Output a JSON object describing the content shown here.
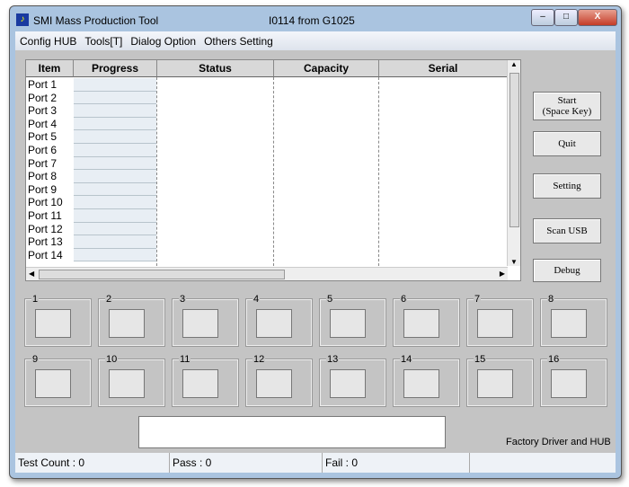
{
  "window": {
    "title": "SMI Mass Production Tool",
    "version": "I0114 from G1025",
    "minimize": "–",
    "maximize": "□",
    "close": "X"
  },
  "menu": [
    "Config HUB",
    "Tools[T]",
    "Dialog Option",
    "Others Setting"
  ],
  "table": {
    "headers": [
      "Item",
      "Progress",
      "Status",
      "Capacity",
      "Serial"
    ],
    "rows": [
      "Port 1",
      "Port 2",
      "Port 3",
      "Port 4",
      "Port 5",
      "Port 6",
      "Port 7",
      "Port 8",
      "Port 9",
      "Port 10",
      "Port 11",
      "Port 12",
      "Port 13",
      "Port 14"
    ]
  },
  "buttons": {
    "start": "Start\n(Space Key)",
    "quit": "Quit",
    "setting": "Setting",
    "scan": "Scan USB",
    "debug": "Debug"
  },
  "slots": [
    "1",
    "2",
    "3",
    "4",
    "5",
    "6",
    "7",
    "8",
    "9",
    "10",
    "11",
    "12",
    "13",
    "14",
    "15",
    "16"
  ],
  "factory_label": "Factory Driver and HUB",
  "status": {
    "test_count": "Test Count : 0",
    "pass": "Pass : 0",
    "fail": "Fail : 0"
  }
}
